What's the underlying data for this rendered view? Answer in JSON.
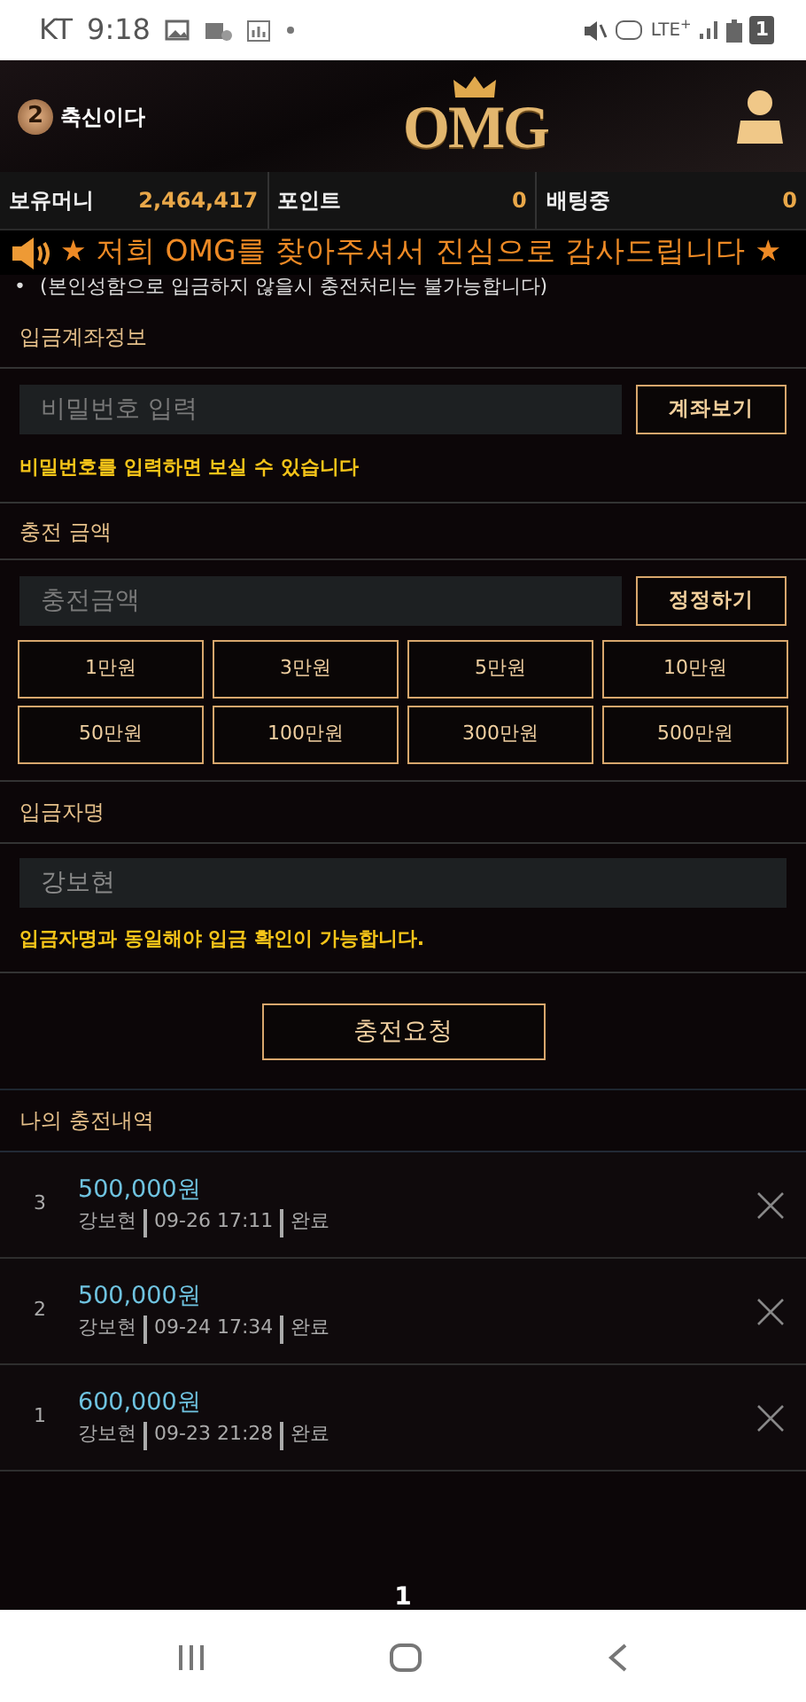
{
  "status_bar": {
    "carrier": "KT",
    "time": "9:18",
    "network": "LTE$^{+}$",
    "sim_badge": "1"
  },
  "header": {
    "level": "2",
    "username": "축신이다",
    "logo": "OMG"
  },
  "balances": [
    {
      "label": "보유머니",
      "value": "2,464,417"
    },
    {
      "label": "포인트",
      "value": "0"
    },
    {
      "label": "배팅중",
      "value": "0"
    }
  ],
  "notice": {
    "text": "★ 저희 OMG를 찾아주셔서 진심으로 감사드립니다 ★",
    "bullet": "•",
    "sub": "(본인성함으로 입금하지 않을시 충전처리는 불가능합니다)"
  },
  "account_section": {
    "title": "입금계좌정보",
    "placeholder": "비밀번호 입력",
    "button": "계좌보기",
    "hint": "비밀번호를 입력하면 보실 수 있습니다"
  },
  "amount_section": {
    "title": "충전 금액",
    "placeholder": "충전금액",
    "button": "정정하기",
    "presets": [
      "1만원",
      "3만원",
      "5만원",
      "10만원",
      "50만원",
      "100만원",
      "300만원",
      "500만원"
    ]
  },
  "depositor_section": {
    "title": "입금자명",
    "value": "강보현",
    "hint": "입금자명과 동일해야 입금 확인이 가능합니다."
  },
  "submit": "충전요청",
  "history": {
    "title": "나의 충전내역",
    "rows": [
      {
        "index": "3",
        "amount": "500,000원",
        "name": "강보현",
        "time": "09-26 17:11",
        "status": "완료"
      },
      {
        "index": "2",
        "amount": "500,000원",
        "name": "강보현",
        "time": "09-24 17:34",
        "status": "완료"
      },
      {
        "index": "1",
        "amount": "600,000원",
        "name": "강보현",
        "time": "09-23 21:28",
        "status": "완료"
      }
    ]
  },
  "pagination": [
    {
      "label": "1",
      "selected": true
    }
  ]
}
